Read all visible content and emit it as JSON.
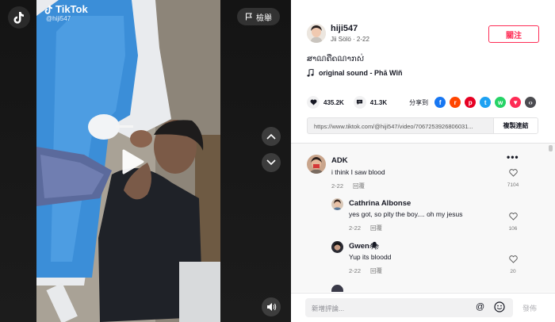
{
  "video": {
    "brand": "TikTok",
    "watermark_user": "@hiji547",
    "report_label": "檢舉"
  },
  "author": {
    "username": "hiji547",
    "display_name": "Jii Sölö",
    "date": "2-22",
    "follow_label": "關注"
  },
  "caption": "ສາណຄືຄណາກស់",
  "music": "original sound - Phā Wîñ",
  "stats": {
    "likes": "435.2K",
    "comments": "41.3K",
    "share_label": "分享到"
  },
  "share_icons": [
    {
      "name": "facebook-share-icon",
      "color": "#1877f2",
      "glyph": "f"
    },
    {
      "name": "reddit-share-icon",
      "color": "#ff4500",
      "glyph": "r"
    },
    {
      "name": "pinterest-share-icon",
      "color": "#e60023",
      "glyph": "p"
    },
    {
      "name": "twitter-share-icon",
      "color": "#1da1f2",
      "glyph": "t"
    },
    {
      "name": "whatsapp-share-icon",
      "color": "#25d366",
      "glyph": "w"
    },
    {
      "name": "telegram-share-icon",
      "color": "#fe2c55",
      "glyph": "▼"
    },
    {
      "name": "embed-share-icon",
      "color": "#4b4b50",
      "glyph": "‹›"
    }
  ],
  "link": {
    "url": "https://www.tiktok.com/@hiji547/video/7067253926806031...",
    "copy_label": "複製連結"
  },
  "comments": [
    {
      "name": "ADK",
      "text": "i think I saw blood",
      "date": "2-22",
      "reply_label": "回覆",
      "likes": "7104"
    },
    {
      "name": "Cathrina Albonse",
      "text": "yes got, so pity the boy.... oh my jesus",
      "date": "2-22",
      "reply_label": "回覆",
      "likes": "106"
    },
    {
      "name": "Gwen🕷",
      "text": "Yup its bloodd",
      "date": "2-22",
      "reply_label": "回覆",
      "likes": "20"
    }
  ],
  "comment_bar": {
    "placeholder": "新增評論...",
    "post_label": "發佈"
  },
  "colors": {
    "accent": "#fe2c55",
    "text": "#161823"
  }
}
